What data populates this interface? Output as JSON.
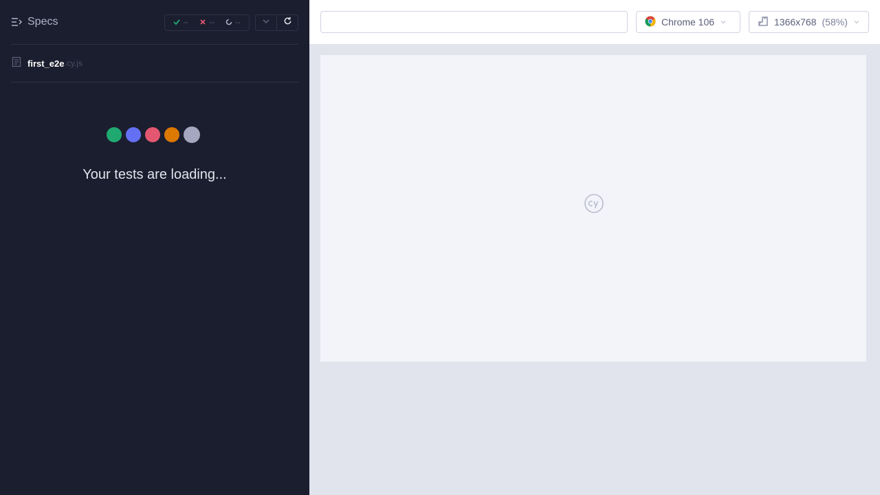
{
  "reporter": {
    "specs_label": "Specs",
    "stats": {
      "passed": "--",
      "failed": "--",
      "pending": "--"
    },
    "spec": {
      "name": "first_e2e",
      "ext": ".cy.js"
    },
    "loading_text": "Your tests are loading...",
    "dot_colors": [
      "#1fa971",
      "#6470f3",
      "#e45770",
      "#db7903",
      "#a3a7c0"
    ]
  },
  "topbar": {
    "url_value": "",
    "browser": "Chrome 106",
    "viewport": "1366x768",
    "scale": "(58%)"
  },
  "colors": {
    "panel_bg": "#1b1e2e",
    "preview_bg": "#f3f4fa",
    "passed": "#1fa971",
    "failed": "#e45770"
  }
}
